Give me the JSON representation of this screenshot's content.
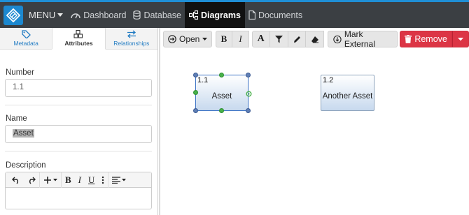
{
  "nav": {
    "menu_label": "MENU",
    "items": [
      {
        "label": "Dashboard",
        "icon": "dashboard-icon"
      },
      {
        "label": "Database",
        "icon": "database-icon"
      },
      {
        "label": "Diagrams",
        "icon": "diagram-icon",
        "active": true
      },
      {
        "label": "Documents",
        "icon": "document-icon"
      }
    ]
  },
  "left_panel": {
    "tabs": [
      {
        "label": "Metadata",
        "icon": "tag-icon"
      },
      {
        "label": "Attributes",
        "icon": "cubes-icon",
        "active": true
      },
      {
        "label": "Relationships",
        "icon": "exchange-icon"
      }
    ],
    "number": {
      "label": "Number",
      "value": "1.1"
    },
    "name": {
      "label": "Name",
      "value": "Asset"
    },
    "description": {
      "label": "Description",
      "value": ""
    }
  },
  "toolbar": {
    "open_label": "Open",
    "mark_external_label": "Mark External",
    "remove_label": "Remove"
  },
  "diagram": {
    "nodes": [
      {
        "number": "1.1",
        "label": "Asset",
        "selected": true
      },
      {
        "number": "1.2",
        "label": "Another Asset",
        "selected": false
      }
    ]
  },
  "colors": {
    "accent": "#1f8fd6",
    "nav_bg": "#3b3f43",
    "remove": "#dc3545",
    "handle_green": "#49b14a",
    "handle_blue": "#5f7fb5"
  }
}
